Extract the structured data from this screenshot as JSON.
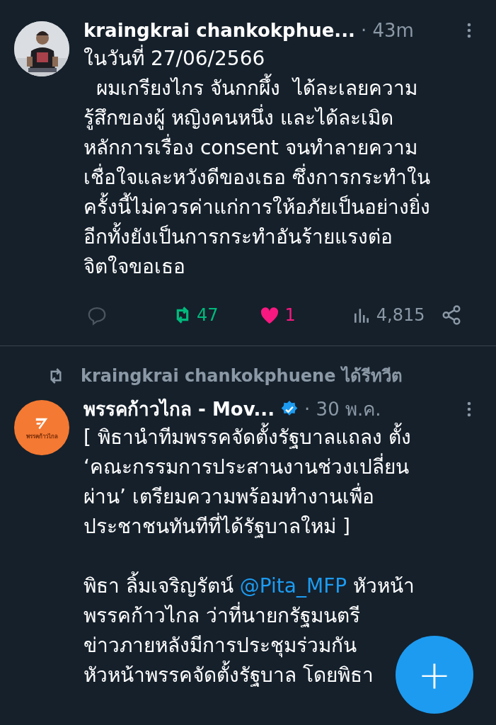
{
  "tweets": [
    {
      "kind": "tweet",
      "author": "kraingkrai chankokphue...",
      "verified": false,
      "time": "· 43m",
      "body": [
        [
          {
            "kind": "text",
            "text": "ในวันที่ 27/06/2566\n  ผมเกรียงไกร จันกกผึ้ง  ได้ละเลยความ\nรู้สึกของผู้ หญิงคนหนึ่ง และได้ละเมิด\nหลักการเรื่อง consent จนทำลายความ\nเชื่อใจและหวังดีของเธอ ซึ่งการกระทำใน\nครั้งนี้ไม่ควรค่าแก่การให้อภัยเป็นอย่างยิ่ง\nอีกทั้งยังเป็นการกระทำอันร้ายแรงต่อ\nจิตใจขอเธอ"
          }
        ]
      ],
      "stats": {
        "retweets": "47",
        "retweeted": true,
        "likes": "1",
        "liked": true,
        "views": "4,815"
      }
    },
    {
      "kind": "retweet",
      "retweeted_by": "kraingkrai chankokphuene ได้รีทวีต",
      "author": "พรรคก้าวไกล - Mov...",
      "verified": true,
      "time": "· 30 พ.ค.",
      "avatar_text": "พรรคก้าวไกล",
      "body": [
        [
          {
            "kind": "text",
            "text": "[ พิธานำทีมพรรคจัดตั้งรัฐบาลแถลง ตั้ง\n‘คณะกรรมการประสานงานช่วงเปลี่ยน\nผ่าน’ เตรียมความพร้อมทำงานเพื่อ\nประชาชนทันทีที่ได้รัฐบาลใหม่ ]"
          }
        ],
        [
          {
            "kind": "text",
            "text": "พิธา ลิ้มเจริญรัตน์ "
          },
          {
            "kind": "mention",
            "text": "@Pita_MFP"
          },
          {
            "kind": "text",
            "text": " หัวหน้า\nพรรคก้าวไกล ว่าที่นายกรัฐมนตรี\nข่าวภายหลังมีการประชุมร่วมกัน\nหัวหน้าพรรคจัดตั้งรัฐบาล โดยพิธา"
          }
        ]
      ]
    }
  ],
  "fab": {
    "label": "+"
  }
}
